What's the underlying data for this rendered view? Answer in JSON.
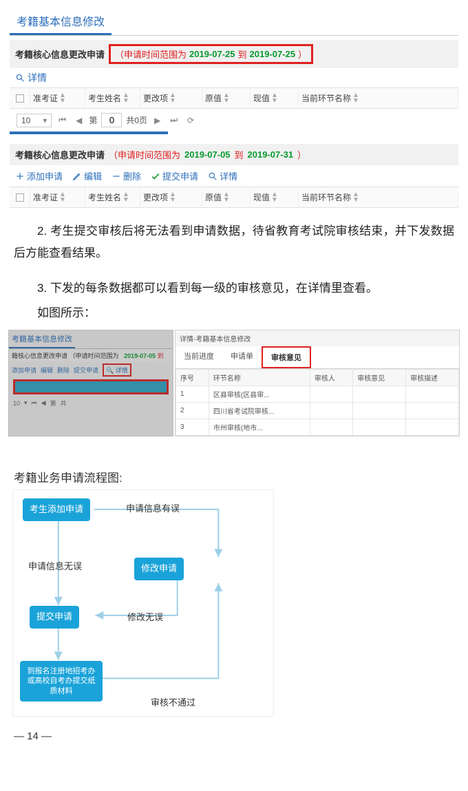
{
  "top": {
    "tab_title": "考籍基本信息修改",
    "bar1_label": "考籍核心信息更改申请",
    "bar1_range_prefix": "（申请时间范围为",
    "date1_from": "2019-07-25",
    "date_to_word": "到",
    "date1_to": "2019-07-25",
    "bar1_range_suffix": "）",
    "detail_btn": "详情",
    "cols": {
      "c1": "准考证",
      "c2": "考生姓名",
      "c3": "更改项",
      "c4": "原值",
      "c5": "现值",
      "c6": "当前环节名称"
    },
    "pager": {
      "size": "10",
      "page_label_prefix": "第",
      "page_value": "0",
      "total": "共0页"
    },
    "bar2_label": "考籍核心信息更改申请",
    "bar2_range_prefix": "（申请时间范围为",
    "date2_from": "2019-07-05",
    "date2_to": "2019-07-31",
    "bar2_range_suffix": "）",
    "toolbar": {
      "add": "添加申请",
      "edit": "编辑",
      "del": "删除",
      "submit": "提交申请",
      "detail": "详情"
    }
  },
  "body": {
    "p2": "2. 考生提交审核后将无法看到申请数据，待省教育考试院审核结束，并下发数据后方能查看结果。",
    "p3": "3. 下发的每条数据都可以看到每一级的审核意见，在详情里查看。",
    "p_fig": "如图所示："
  },
  "shot2": {
    "left": {
      "tab": "考籍基本信息修改",
      "bar": "籍核心信息更改申请 （申请时间范围为",
      "bar_date": "2019-07-05",
      "bar_to": "到",
      "tool_add": "添加申请",
      "tool_edit": "编辑",
      "tool_del": "删除",
      "tool_submit": "提交申请",
      "tool_detail": "详情",
      "pager_size": "10",
      "pager_page": "第",
      "pager_total": "共"
    },
    "right": {
      "title": "详情-考籍基本信息修改",
      "tab_a": "当前进度",
      "tab_b": "申请单",
      "tab_c": "审核意见",
      "th_no": "序号",
      "th_name": "环节名称",
      "th_person": "审核人",
      "th_opinion": "审核意见",
      "th_desc": "审核描述",
      "rows": [
        {
          "no": "1",
          "name": "区县审核(区县审..."
        },
        {
          "no": "2",
          "name": "四川省考试院审核..."
        },
        {
          "no": "3",
          "name": "市州审核(地市..."
        }
      ]
    }
  },
  "flow": {
    "title": "考籍业务申请流程图:",
    "n1": "考生添加申请",
    "l1": "申请信息有误",
    "l2": "申请信息无误",
    "n2": "修改申请",
    "n3": "提交申请",
    "l3": "修改无误",
    "n4": "到报名注册地招考办或高校自考办提交纸质材料",
    "l4": "审核不通过"
  },
  "pagenum": "— 14 —"
}
